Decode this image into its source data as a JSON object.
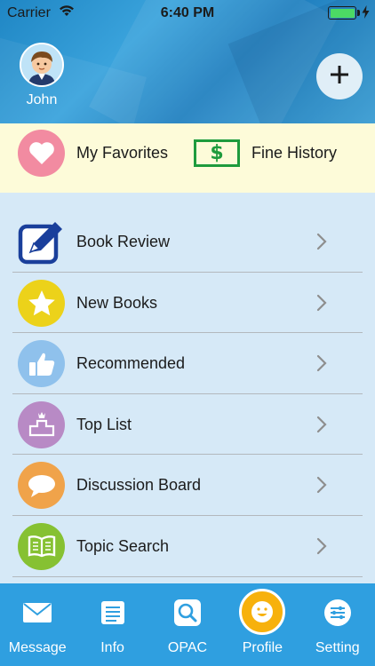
{
  "status_bar": {
    "carrier": "Carrier",
    "time": "6:40 PM"
  },
  "profile": {
    "name": "John"
  },
  "quick_actions": {
    "favorites": "My Favorites",
    "fine_history": "Fine History",
    "fine_symbol": "$"
  },
  "menu": [
    {
      "label": "Book Review",
      "icon": "pencil-icon",
      "color": "#1a3f9b"
    },
    {
      "label": "New Books",
      "icon": "star-icon",
      "color": "#ecd21a"
    },
    {
      "label": "Recommended",
      "icon": "thumbs-up-icon",
      "color": "#8fc1ec"
    },
    {
      "label": "Top List",
      "icon": "podium-icon",
      "color": "#b88ac5"
    },
    {
      "label": "Discussion Board",
      "icon": "chat-bubble-icon",
      "color": "#f0a34a"
    },
    {
      "label": "Topic Search",
      "icon": "book-icon",
      "color": "#86c132"
    }
  ],
  "tabs": [
    {
      "label": "Message",
      "icon": "envelope-icon"
    },
    {
      "label": "Info",
      "icon": "document-icon"
    },
    {
      "label": "OPAC",
      "icon": "magnifier-icon"
    },
    {
      "label": "Profile",
      "icon": "smiley-icon",
      "active": true
    },
    {
      "label": "Setting",
      "icon": "sliders-icon"
    }
  ],
  "colors": {
    "header": "#2a93d2",
    "quick_row": "#fdfbd9",
    "list_bg": "#d6e9f7",
    "tab_bar": "#2f9fe0",
    "active_tab": "#f7b10c",
    "money_green": "#1e9b3d"
  }
}
